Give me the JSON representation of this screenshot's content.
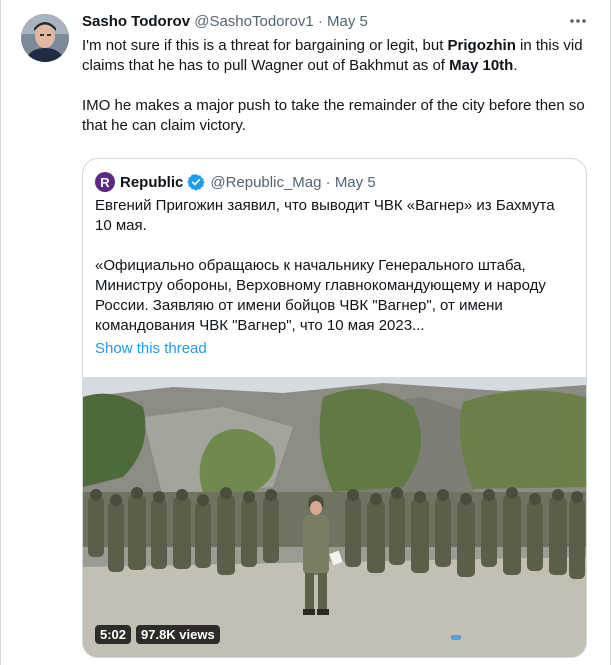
{
  "tweet": {
    "author_name": "Sasho Todorov",
    "author_handle": "@SashoTodorov1",
    "date": "May 5",
    "text_1_a": "I'm not sure if this is a threat for bargaining or legit, but ",
    "text_1_b": "Prigozhin",
    "text_1_c": " in this vid claims that he has to pull Wagner out of Bakhmut as of ",
    "text_1_d": "May 10th",
    "text_1_e": ".",
    "text_2": "IMO he makes a major push to take the remainder of the city before then so that he can claim victory."
  },
  "quote": {
    "logo_letter": "R",
    "name": "Republic",
    "handle": "@Republic_Mag",
    "date": "May 5",
    "text_1": "Евгений Пригожин заявил, что выводит ЧВК «Вагнер» из Бахмута 10 мая.",
    "text_2": "«Официально обращаюсь к начальнику Генерального штаба, Министру обороны, Верховному главнокомандующему и народу России. Заявляю от имени бойцов ЧВК \"Вагнер\", от имени командования ЧВК \"Вагнер\", что 10 мая 2023...",
    "show_thread": "Show this thread"
  },
  "video": {
    "duration": "5:02",
    "views": "97.8K views"
  },
  "colors": {
    "link": "#1d9bf0",
    "verified": "#1d9bf0",
    "secondary_text": "#536471",
    "border": "#cfd9de"
  },
  "icons": {
    "more": "more-dots-icon",
    "verified": "verified-badge-icon"
  }
}
